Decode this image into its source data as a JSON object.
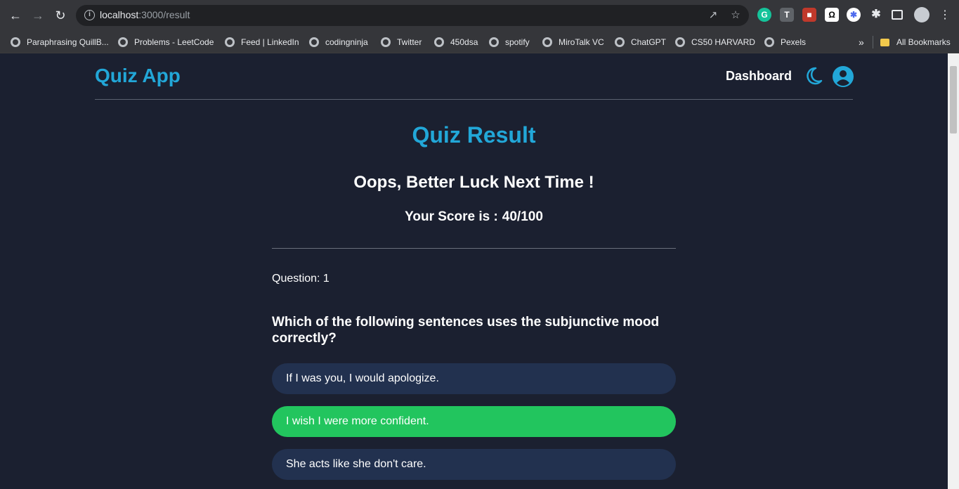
{
  "browser": {
    "url_host": "localhost",
    "url_path": ":3000/result",
    "bookmarks": [
      "Paraphrasing QuillB...",
      "Problems - LeetCode",
      "Feed | LinkedIn",
      "codingninja",
      "Twitter",
      "450dsa",
      "spotify",
      "MiroTalk VC",
      "ChatGPT",
      "CS50 HARVARD",
      "Pexels"
    ],
    "all_bookmarks": "All Bookmarks"
  },
  "header": {
    "app_title": "Quiz App",
    "dashboard": "Dashboard"
  },
  "result": {
    "title": "Quiz Result",
    "message": "Oops, Better Luck Next Time !",
    "score_label": "Your Score is :",
    "score_value": "40/100"
  },
  "question": {
    "number_label": "Question: 1",
    "text": "Which of the following sentences uses the subjunctive mood correctly?",
    "options": [
      {
        "text": "If I was you, I would apologize.",
        "correct": false
      },
      {
        "text": "I wish I were more confident.",
        "correct": true
      },
      {
        "text": "She acts like she don't care.",
        "correct": false
      }
    ]
  },
  "colors": {
    "accent": "#22a7d8",
    "correct": "#22c55e",
    "option_bg": "#22314f",
    "page_bg": "#1b2030"
  }
}
